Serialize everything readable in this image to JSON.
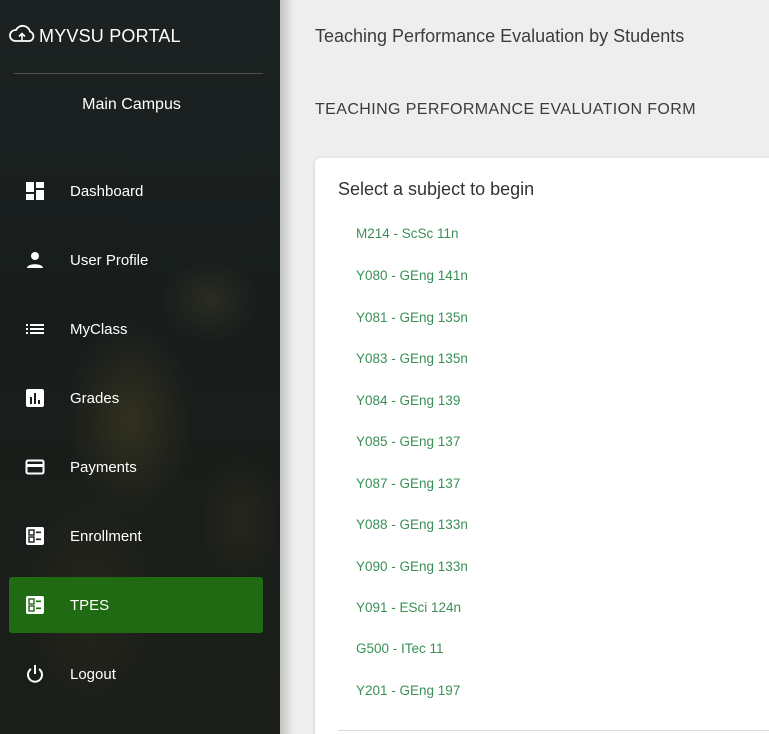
{
  "brand": {
    "title": "MYVSU PORTAL",
    "icon": "cloud-icon"
  },
  "campus": "Main Campus",
  "sidebar": {
    "items": [
      {
        "label": "Dashboard",
        "icon": "dashboard-icon"
      },
      {
        "label": "User Profile",
        "icon": "person-icon"
      },
      {
        "label": "MyClass",
        "icon": "list-icon"
      },
      {
        "label": "Grades",
        "icon": "bar-chart-icon"
      },
      {
        "label": "Payments",
        "icon": "credit-card-icon"
      },
      {
        "label": "Enrollment",
        "icon": "enrollment-icon"
      },
      {
        "label": "TPES",
        "icon": "tpes-icon",
        "active": true
      },
      {
        "label": "Logout",
        "icon": "power-icon"
      }
    ],
    "active_color": "#1f6a12"
  },
  "header": {
    "title": "Teaching Performance Evaluation by Students"
  },
  "main": {
    "form_heading": "TEACHING PERFORMANCE EVALUATION FORM",
    "card_title": "Select a subject to begin",
    "subjects": [
      "M214 - ScSc 11n",
      "Y080 - GEng 141n",
      "Y081 - GEng 135n",
      "Y083 - GEng 135n",
      "Y084 - GEng 139",
      "Y085 - GEng 137",
      "Y087 - GEng 137",
      "Y088 - GEng 133n",
      "Y090 - GEng 133n",
      "Y091 - ESci 124n",
      "G500 - ITec 11",
      "Y201 - GEng 197"
    ],
    "link_color": "#3a8f57"
  }
}
